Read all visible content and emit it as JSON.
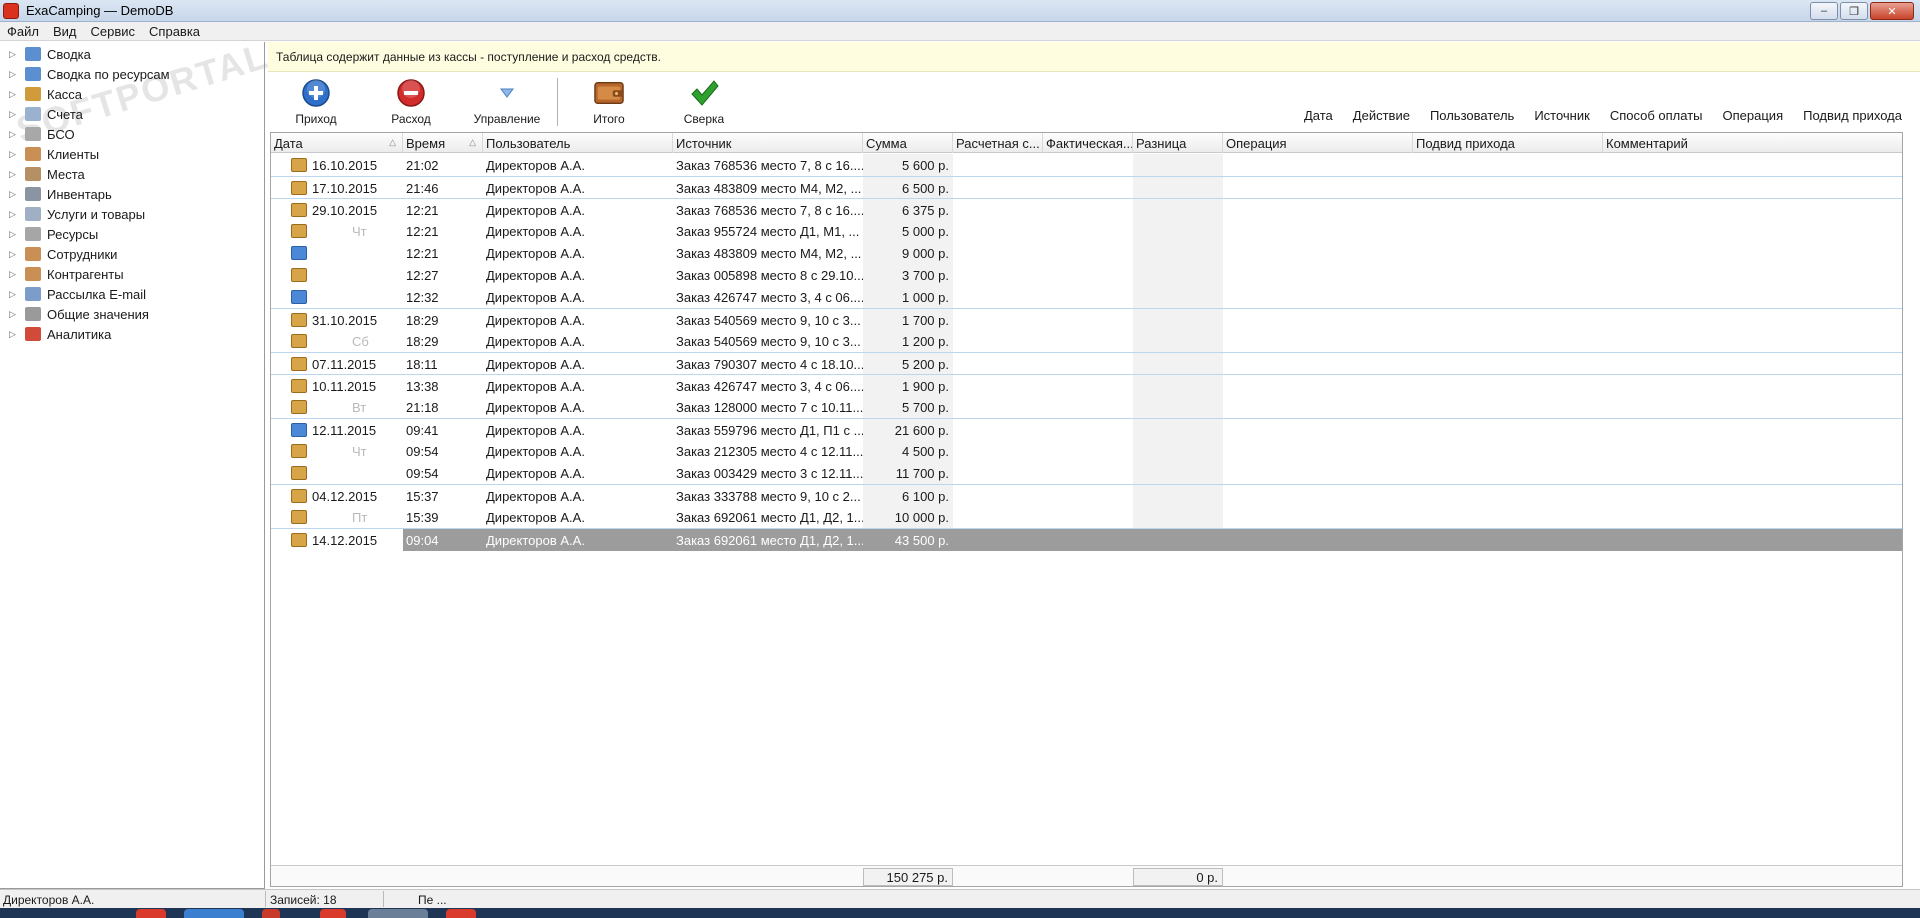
{
  "window": {
    "title": "ExaCamping — DemoDB"
  },
  "menu": [
    "Файл",
    "Вид",
    "Сервис",
    "Справка"
  ],
  "sidebar": {
    "items": [
      {
        "label": "Сводка",
        "icon": "summary-icon",
        "color": "#5b8fd0"
      },
      {
        "label": "Сводка по ресурсам",
        "icon": "resource-summary-icon",
        "color": "#5b8fd0"
      },
      {
        "label": "Касса",
        "icon": "cash-register-icon",
        "color": "#d19a3a"
      },
      {
        "label": "Счета",
        "icon": "invoices-icon",
        "color": "#9ab1cf"
      },
      {
        "label": "БСО",
        "icon": "forms-icon",
        "color": "#a8a8a8"
      },
      {
        "label": "Клиенты",
        "icon": "clients-icon",
        "color": "#c98f55"
      },
      {
        "label": "Места",
        "icon": "places-icon",
        "color": "#b59064"
      },
      {
        "label": "Инвентарь",
        "icon": "inventory-icon",
        "color": "#8a94a3"
      },
      {
        "label": "Услуги и товары",
        "icon": "services-icon",
        "color": "#9fb0c4"
      },
      {
        "label": "Ресурсы",
        "icon": "resources-icon",
        "color": "#a6a6a6"
      },
      {
        "label": "Сотрудники",
        "icon": "employees-icon",
        "color": "#c98f55"
      },
      {
        "label": "Контрагенты",
        "icon": "contractors-icon",
        "color": "#c98f55"
      },
      {
        "label": "Рассылка E-mail",
        "icon": "email-icon",
        "color": "#7c9cc9"
      },
      {
        "label": "Общие значения",
        "icon": "settings-icon",
        "color": "#9a9a9a"
      },
      {
        "label": "Аналитика",
        "icon": "analytics-icon",
        "color": "#d24a3a"
      }
    ],
    "watermark": "SOFTPORTAL"
  },
  "infobar": {
    "text": "Таблица содержит данные из кассы - поступление и расход средств."
  },
  "toolbar": {
    "income": "Приход",
    "expense": "Расход",
    "manage": "Управление",
    "total": "Итого",
    "reconcile": "Сверка"
  },
  "group_fields": [
    "Дата",
    "Действие",
    "Пользователь",
    "Источник",
    "Способ оплаты",
    "Операция",
    "Подвид прихода"
  ],
  "columns": [
    "Дата",
    "Время",
    "Пользователь",
    "Источник",
    "Сумма",
    "Расчетная с...",
    "Фактическая...",
    "Разница",
    "Операция",
    "Подвид прихода",
    "Комментарий"
  ],
  "rows": [
    {
      "date": "16.10.2015",
      "time": "21:02",
      "user": "Директоров А.А.",
      "source": "Заказ 768536 место 7, 8 с 16....",
      "sum": "5 600 р.",
      "pay": "cash",
      "sep": false
    },
    {
      "date": "17.10.2015",
      "time": "21:46",
      "user": "Директоров А.А.",
      "source": "Заказ 483809 место М4, М2, ...",
      "sum": "6 500 р.",
      "pay": "cash",
      "sep": true
    },
    {
      "date": "29.10.2015",
      "time": "12:21",
      "user": "Директоров А.А.",
      "source": "Заказ 768536 место 7, 8 с 16....",
      "sum": "6 375 р.",
      "pay": "cash",
      "sep": true
    },
    {
      "date": "Чт",
      "time": "12:21",
      "user": "Директоров А.А.",
      "source": "Заказ 955724 место Д1, М1, ...",
      "sum": "5 000 р.",
      "pay": "cash",
      "weekday": true
    },
    {
      "date": "",
      "time": "12:21",
      "user": "Директоров А.А.",
      "source": "Заказ 483809 место М4, М2, ...",
      "sum": "9 000 р.",
      "pay": "card"
    },
    {
      "date": "",
      "time": "12:27",
      "user": "Директоров А.А.",
      "source": "Заказ 005898 место 8 с 29.10....",
      "sum": "3 700 р.",
      "pay": "cash"
    },
    {
      "date": "",
      "time": "12:32",
      "user": "Директоров А.А.",
      "source": "Заказ 426747 место 3, 4 с 06....",
      "sum": "1 000 р.",
      "pay": "card"
    },
    {
      "date": "31.10.2015",
      "time": "18:29",
      "user": "Директоров А.А.",
      "source": "Заказ 540569 место 9, 10 с 3...",
      "sum": "1 700 р.",
      "pay": "cash",
      "sep": true
    },
    {
      "date": "Сб",
      "time": "18:29",
      "user": "Директоров А.А.",
      "source": "Заказ 540569 место 9, 10 с 3...",
      "sum": "1 200 р.",
      "pay": "cash",
      "weekday": true
    },
    {
      "date": "07.11.2015",
      "time": "18:11",
      "user": "Директоров А.А.",
      "source": "Заказ 790307 место 4 с 18.10....",
      "sum": "5 200 р.",
      "pay": "cash",
      "sep": true
    },
    {
      "date": "10.11.2015",
      "time": "13:38",
      "user": "Директоров А.А.",
      "source": "Заказ 426747 место 3, 4 с 06....",
      "sum": "1 900 р.",
      "pay": "cash",
      "sep": true
    },
    {
      "date": "Вт",
      "time": "21:18",
      "user": "Директоров А.А.",
      "source": "Заказ 128000 место 7 с 10.11....",
      "sum": "5 700 р.",
      "pay": "cash",
      "weekday": true
    },
    {
      "date": "12.11.2015",
      "time": "09:41",
      "user": "Директоров А.А.",
      "source": "Заказ 559796 место Д1, П1 с ...",
      "sum": "21 600 р.",
      "pay": "card",
      "sep": true
    },
    {
      "date": "Чт",
      "time": "09:54",
      "user": "Директоров А.А.",
      "source": "Заказ 212305 место 4 с 12.11....",
      "sum": "4 500 р.",
      "pay": "cash",
      "weekday": true
    },
    {
      "date": "",
      "time": "09:54",
      "user": "Директоров А.А.",
      "source": "Заказ 003429 место 3 с 12.11....",
      "sum": "11 700 р.",
      "pay": "cash"
    },
    {
      "date": "04.12.2015",
      "time": "15:37",
      "user": "Директоров А.А.",
      "source": "Заказ 333788 место 9, 10 с 2...",
      "sum": "6 100 р.",
      "pay": "cash",
      "sep": true
    },
    {
      "date": "Пт",
      "time": "15:39",
      "user": "Директоров А.А.",
      "source": "Заказ 692061 место Д1, Д2, 1...",
      "sum": "10 000 р.",
      "pay": "cash",
      "weekday": true
    },
    {
      "date": "14.12.2015",
      "time": "09:04",
      "user": "Директоров А.А.",
      "source": "Заказ 692061 место Д1, Д2, 1...",
      "sum": "43 500 р.",
      "pay": "cash",
      "sep": true,
      "selected": true
    }
  ],
  "footer": {
    "sum_total": "150 275 р.",
    "diff_total": "0 р."
  },
  "status": {
    "user": "Директоров А.А.",
    "records": "Записей: 18",
    "extra": "Пе ..."
  },
  "colors": {
    "accent": "#4b88d8",
    "selection": "#9c9c9c",
    "info_bg": "#fffde0",
    "income": "#2e6fc9",
    "expense": "#d12b2b",
    "ok": "#2ea02e"
  }
}
